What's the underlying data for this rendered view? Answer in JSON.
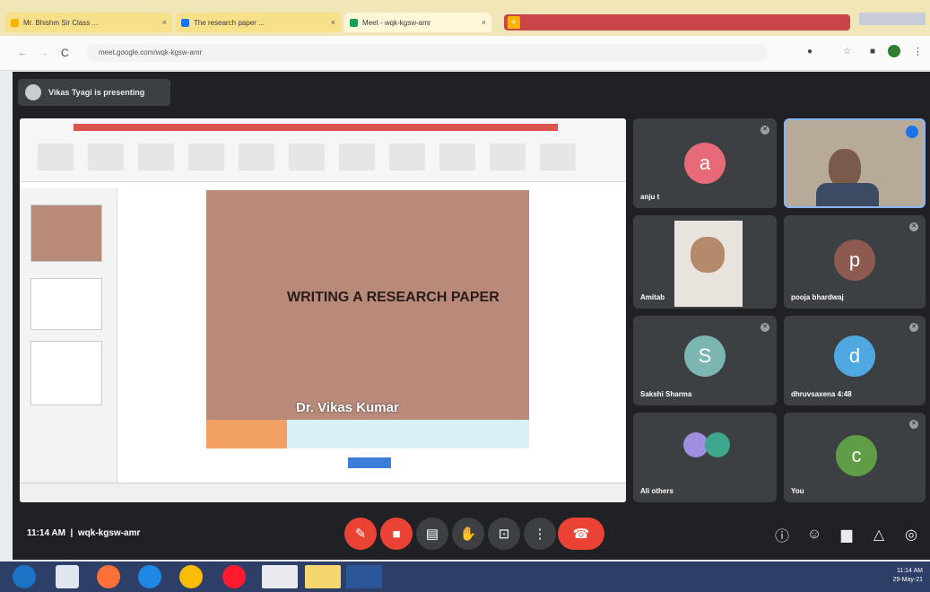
{
  "browser": {
    "tabs": [
      {
        "label": "Mr. Bhishm Sir Class ...",
        "color": "#f4b400"
      },
      {
        "label": "The research paper ...",
        "color": "#1a73e8"
      },
      {
        "label": "Meet - wqk-kgsw-amr",
        "color": "#0f9d58"
      }
    ],
    "url": "meet.google.com/wqk-kgsw-amr"
  },
  "meet": {
    "presenting_text": "Vikas Tyagi is presenting",
    "time": "11:14 AM",
    "meeting_code": "wqk-kgsw-amr"
  },
  "slide": {
    "title": "WRITING  A RESEARCH PAPER",
    "author": "Dr. Vikas Kumar"
  },
  "participants": [
    {
      "name": "anju t",
      "initial": "a",
      "color": "#e66a78"
    },
    {
      "name": "",
      "initial": "",
      "color": ""
    },
    {
      "name": "Amitab",
      "initial": "",
      "color": ""
    },
    {
      "name": "pooja bhardwaj",
      "initial": "p",
      "color": "#8c5a4e"
    },
    {
      "name": "Sakshi Sharma",
      "initial": "S",
      "color": "#7bb6b3"
    },
    {
      "name": "dhruvsaxena 4:48",
      "initial": "d",
      "color": "#4fa8e0"
    },
    {
      "name": "Ali others",
      "initial": "",
      "color": ""
    },
    {
      "name": "You",
      "initial": "c",
      "color": "#5f9e47"
    }
  ],
  "controls": {
    "mic": "mic-off",
    "cam": "cam-off",
    "end": "end-call"
  },
  "taskbar": {
    "time": "11:14 AM",
    "date": "29-May-21"
  }
}
